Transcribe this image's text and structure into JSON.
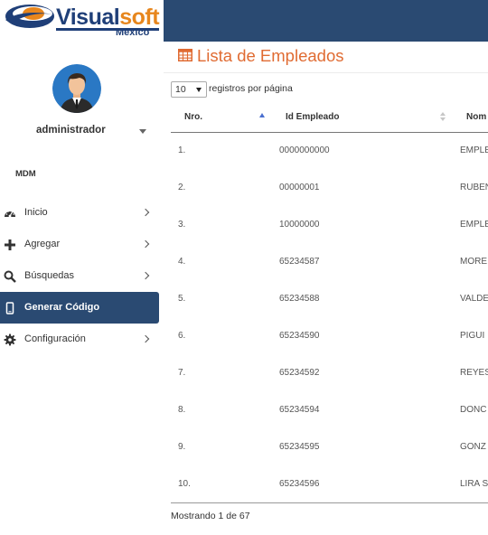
{
  "brand": {
    "name_part1": "Visual",
    "name_part2": "soft",
    "sub": "México",
    "colors": {
      "navy": "#1f3f78",
      "orange": "#e7861d",
      "topbar": "#2a4a72"
    }
  },
  "sidebar": {
    "username": "administrador",
    "section_title": "MDM",
    "items": [
      {
        "label": "Inicio",
        "icon": "dashboard-icon",
        "has_submenu": true,
        "active": false
      },
      {
        "label": "Agregar",
        "icon": "plus-icon",
        "has_submenu": true,
        "active": false
      },
      {
        "label": "Búsquedas",
        "icon": "search-icon",
        "has_submenu": true,
        "active": false
      },
      {
        "label": "Generar Código",
        "icon": "mobile-icon",
        "has_submenu": false,
        "active": true
      },
      {
        "label": "Configuración",
        "icon": "gear-icon",
        "has_submenu": true,
        "active": false
      }
    ]
  },
  "main": {
    "title": "Lista de Empleados",
    "title_icon": "table-icon",
    "title_color": "#e06b32",
    "page_length": {
      "selected": "10",
      "label": "registros por página"
    },
    "table": {
      "headers": [
        "Nro.",
        "Id Empleado",
        "Nom"
      ],
      "sorted_column": "Nro.",
      "rows": [
        {
          "nro": "1.",
          "id": "0000000000",
          "nombre": "EMPLE"
        },
        {
          "nro": "2.",
          "id": "00000001",
          "nombre": "RUBEN"
        },
        {
          "nro": "3.",
          "id": "10000000",
          "nombre": "EMPLE"
        },
        {
          "nro": "4.",
          "id": "65234587",
          "nombre": "MORE"
        },
        {
          "nro": "5.",
          "id": "65234588",
          "nombre": "VALDE"
        },
        {
          "nro": "6.",
          "id": "65234590",
          "nombre": "PIGUI"
        },
        {
          "nro": "7.",
          "id": "65234592",
          "nombre": "REYES"
        },
        {
          "nro": "8.",
          "id": "65234594",
          "nombre": "DONC"
        },
        {
          "nro": "9.",
          "id": "65234595",
          "nombre": "GONZ"
        },
        {
          "nro": "10.",
          "id": "65234596",
          "nombre": "LIRA S"
        }
      ]
    },
    "info": "Mostrando 1 de 67"
  }
}
